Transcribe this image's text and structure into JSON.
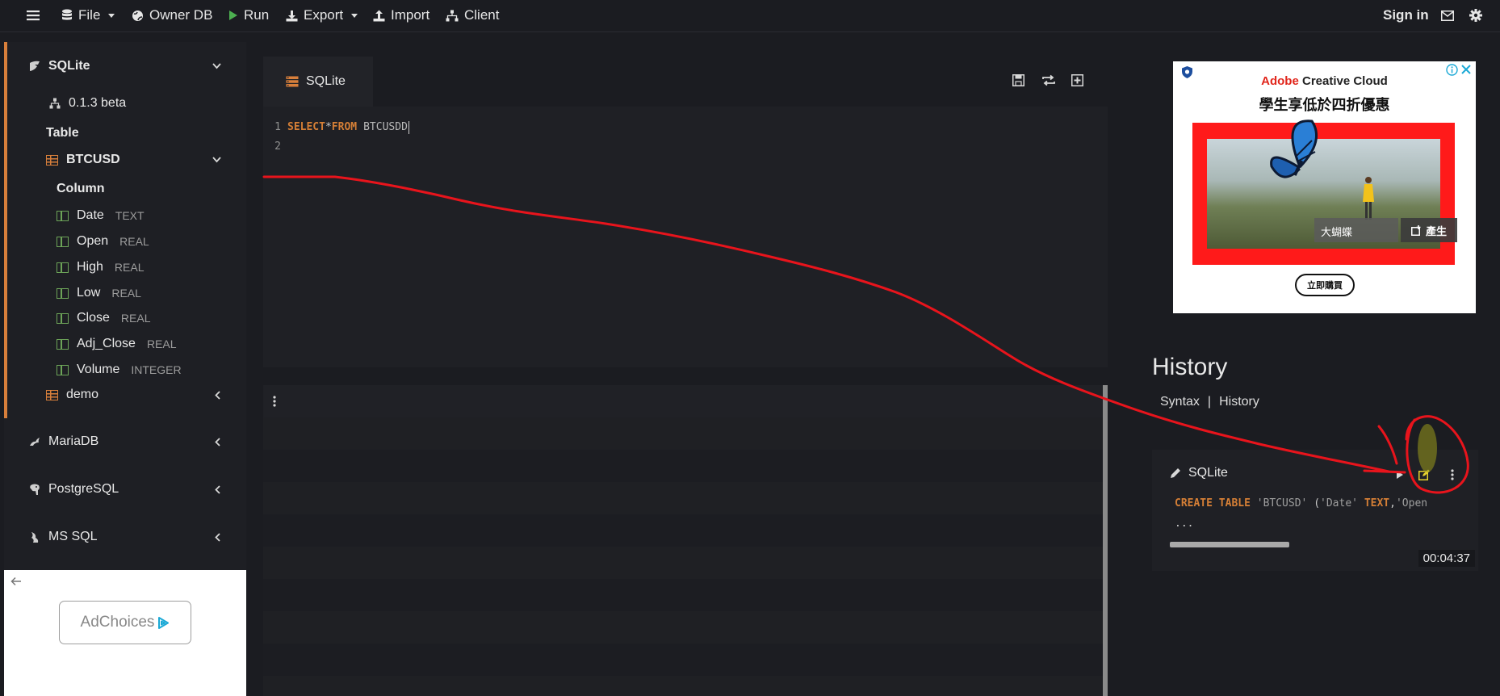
{
  "toolbar": {
    "file": "File",
    "owner_db": "Owner DB",
    "run": "Run",
    "export": "Export",
    "import": "Import",
    "client": "Client",
    "sign_in": "Sign in"
  },
  "sidebar": {
    "sqlite": "SQLite",
    "version": "0.1.3 beta",
    "table_heading": "Table",
    "table_btcusd": "BTCUSD",
    "column_heading": "Column",
    "columns": [
      {
        "name": "Date",
        "type": "TEXT"
      },
      {
        "name": "Open",
        "type": "REAL"
      },
      {
        "name": "High",
        "type": "REAL"
      },
      {
        "name": "Low",
        "type": "REAL"
      },
      {
        "name": "Close",
        "type": "REAL"
      },
      {
        "name": "Adj_Close",
        "type": "REAL"
      },
      {
        "name": "Volume",
        "type": "INTEGER"
      }
    ],
    "table_demo": "demo",
    "mariadb": "MariaDB",
    "postgresql": "PostgreSQL",
    "mssql": "MS SQL"
  },
  "ad_left": {
    "label": "AdChoices"
  },
  "editor": {
    "tab_label": "SQLite",
    "lines": [
      {
        "num": "1",
        "kw1": "SELECT",
        "op": "*",
        "kw2": "FROM",
        "ident": "BTCUSDD"
      },
      {
        "num": "2"
      }
    ]
  },
  "ad_right": {
    "brand_a": "Adobe",
    "brand_b": "Creative Cloud",
    "headline": "學生享低於四折優惠",
    "prompt_text": "大蝴蝶",
    "generate": "產生",
    "cta": "立即購買"
  },
  "history": {
    "title": "History",
    "tab_syntax": "Syntax",
    "separator": "|",
    "tab_history": "History",
    "entry": {
      "db": "SQLite",
      "kw": "CREATE TABLE",
      "table": "'BTCUSD'",
      "paren": "(",
      "col1": "'Date'",
      "type1": "TEXT",
      "comma": ",",
      "col2": "'Open",
      "ellipsis": "...",
      "time": "00:04:37"
    }
  },
  "colors": {
    "accent_orange": "#d87f3b",
    "column_green": "#6ca358",
    "run_green": "#4caf50",
    "annotation_red": "#e8141c"
  }
}
